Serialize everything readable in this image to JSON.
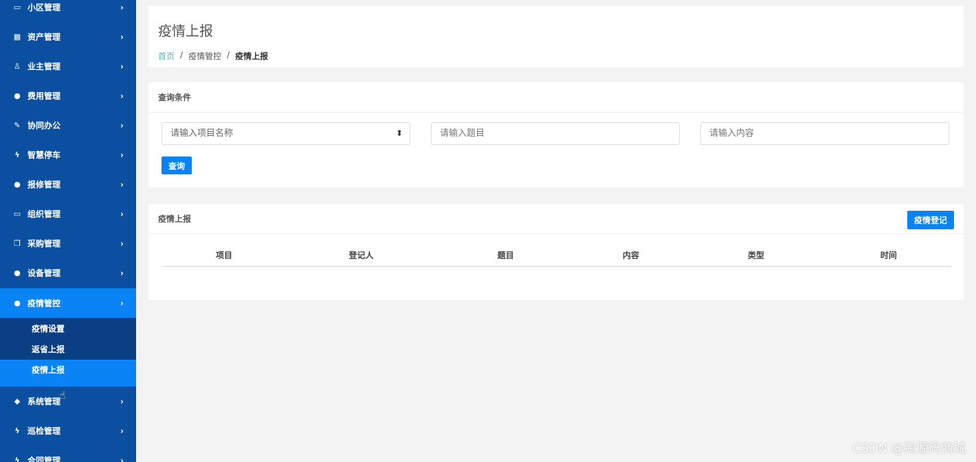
{
  "sidebar": {
    "items": [
      {
        "label": "小区管理",
        "icon": "laptop-icon",
        "glyph": "▭"
      },
      {
        "label": "资产管理",
        "icon": "grid-icon",
        "glyph": "▦"
      },
      {
        "label": "业主管理",
        "icon": "user-icon",
        "glyph": "♙"
      },
      {
        "label": "费用管理",
        "icon": "globe-icon",
        "glyph": "●"
      },
      {
        "label": "协同办公",
        "icon": "edit-icon",
        "glyph": "✎"
      },
      {
        "label": "智慧停车",
        "icon": "bolt-icon",
        "glyph": "ϟ"
      },
      {
        "label": "报修管理",
        "icon": "globe-icon",
        "glyph": "●"
      },
      {
        "label": "组织管理",
        "icon": "monitor-icon",
        "glyph": "▭"
      },
      {
        "label": "采购管理",
        "icon": "copy-icon",
        "glyph": "❐"
      },
      {
        "label": "设备管理",
        "icon": "globe-icon",
        "glyph": "●"
      },
      {
        "label": "疫情管控",
        "icon": "globe-icon",
        "glyph": "●"
      },
      {
        "label": "系统管理",
        "icon": "diamond-icon",
        "glyph": "◆"
      },
      {
        "label": "巡检管理",
        "icon": "bolt-icon",
        "glyph": "ϟ"
      },
      {
        "label": "合同管理",
        "icon": "bolt-icon",
        "glyph": "ϟ"
      }
    ],
    "sub_items": [
      {
        "label": "疫情设置"
      },
      {
        "label": "返省上报"
      },
      {
        "label": "疫情上报"
      }
    ],
    "chevron": "›"
  },
  "header": {
    "title": "疫情上报",
    "breadcrumb": [
      "首页",
      "疫情管控",
      "疫情上报"
    ],
    "separator": "/"
  },
  "query": {
    "title": "查询条件",
    "project_placeholder": "请输入项目名称",
    "subject_placeholder": "请输入题目",
    "content_placeholder": "请输入内容",
    "search_label": "查询"
  },
  "list": {
    "title": "疫情上报",
    "register_label": "疫情登记",
    "columns": [
      "项目",
      "登记人",
      "题目",
      "内容",
      "类型",
      "时间"
    ]
  },
  "watermark": "CSDN @淘源码商城",
  "colors": {
    "sidebar": "#0b4fa0",
    "active": "#0a84f5",
    "accent_link": "#5bb9a8"
  }
}
